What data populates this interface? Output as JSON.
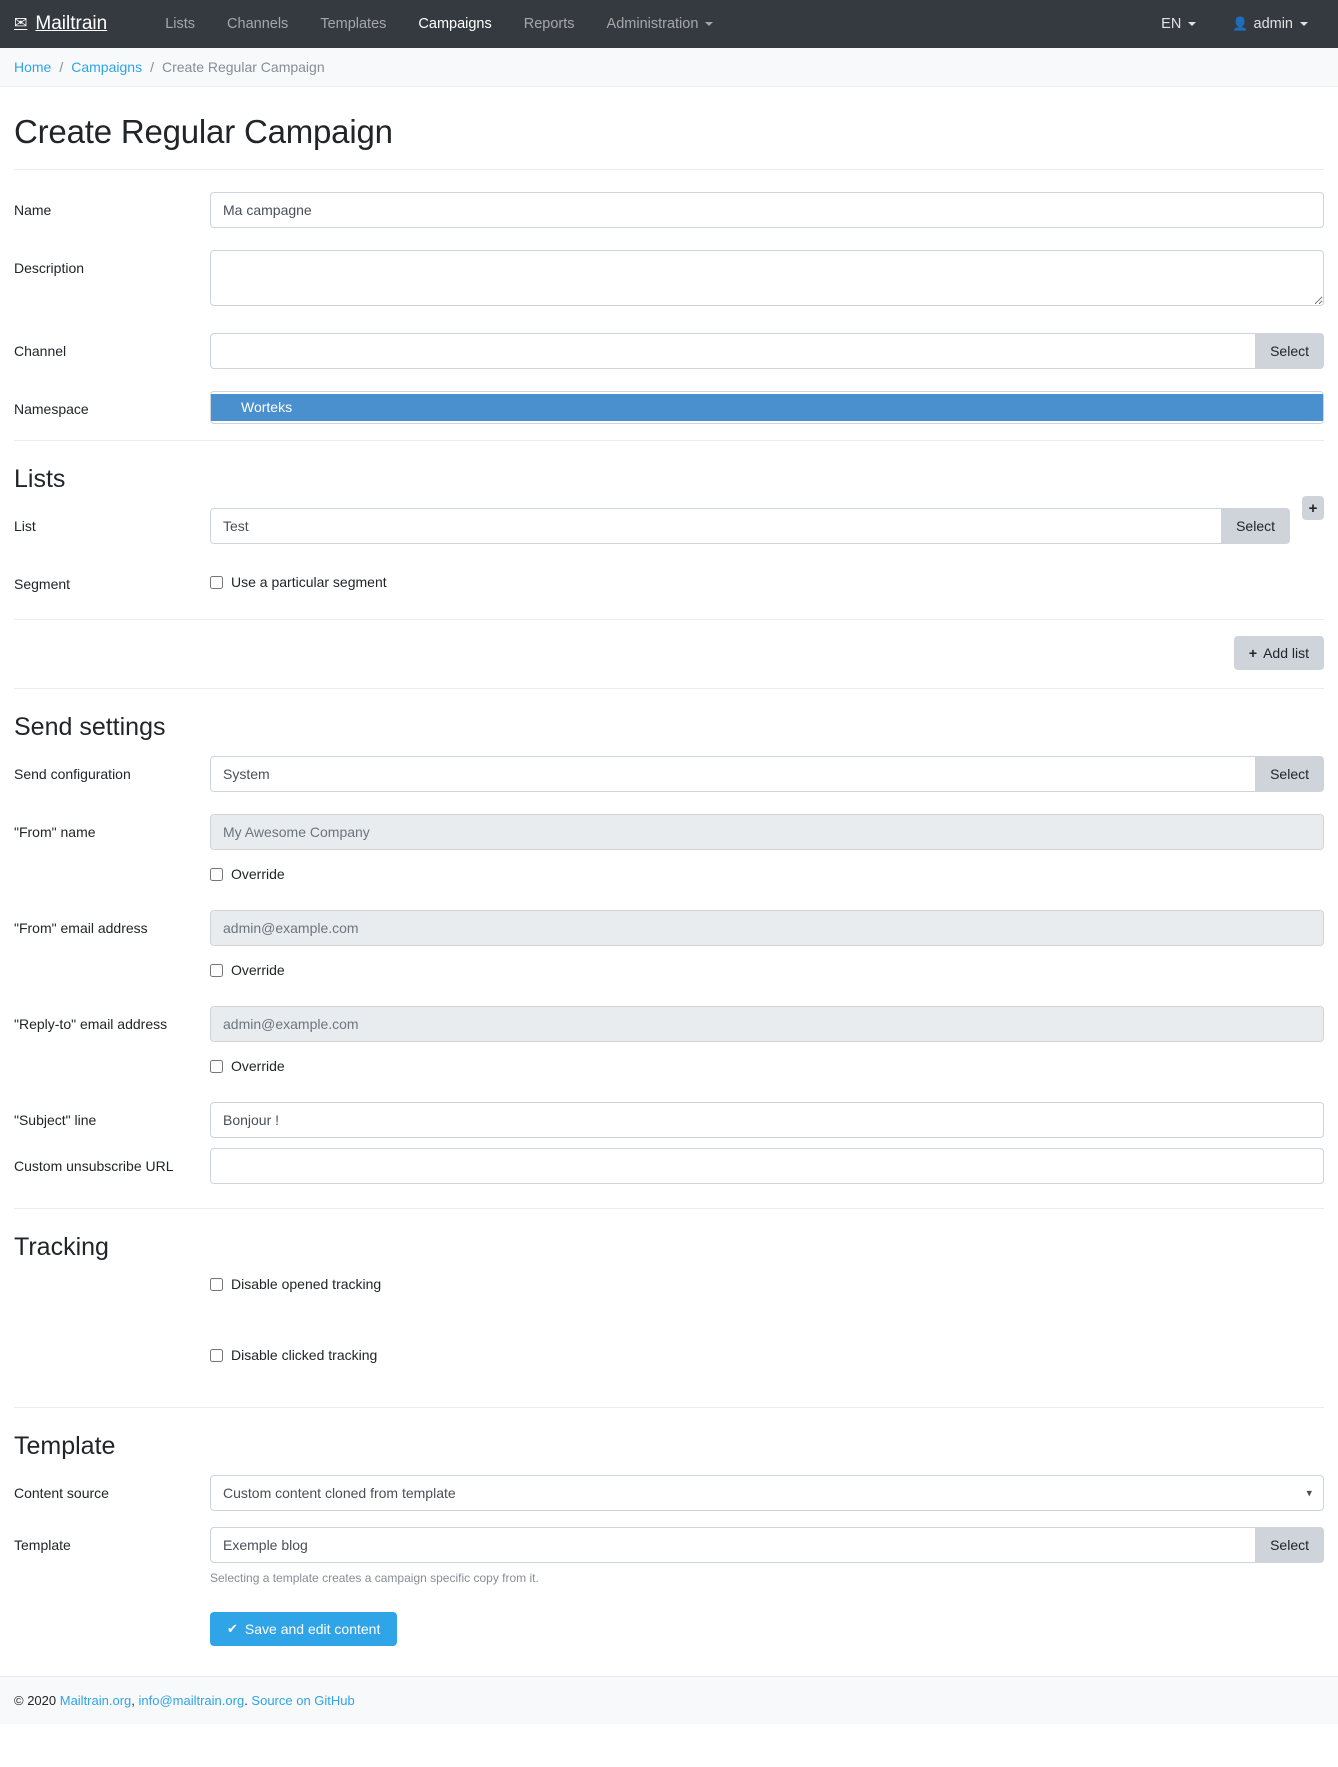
{
  "navbar": {
    "brand": "Mailtrain",
    "brand_icon": "envelope-icon",
    "items": [
      {
        "label": "Lists",
        "active": false
      },
      {
        "label": "Channels",
        "active": false
      },
      {
        "label": "Templates",
        "active": false
      },
      {
        "label": "Campaigns",
        "active": true
      },
      {
        "label": "Reports",
        "active": false
      },
      {
        "label": "Administration",
        "active": false,
        "has_caret": true
      }
    ],
    "language": "EN",
    "user": "admin"
  },
  "breadcrumb": {
    "home": "Home",
    "campaigns": "Campaigns",
    "current": "Create Regular Campaign",
    "separator": "/"
  },
  "page": {
    "title": "Create Regular Campaign"
  },
  "form": {
    "name": {
      "label": "Name",
      "value": "Ma campagne",
      "placeholder": ""
    },
    "description": {
      "label": "Description",
      "value": "",
      "placeholder": ""
    },
    "channel": {
      "label": "Channel",
      "value": "",
      "placeholder": "",
      "select_label": "Select"
    },
    "namespace": {
      "label": "Namespace",
      "options": [
        "Worteks"
      ],
      "selected": "Worteks"
    }
  },
  "lists": {
    "section_title": "Lists",
    "list": {
      "label": "List",
      "value": "Test",
      "select_label": "Select",
      "add_icon": "plus-icon"
    },
    "segment": {
      "label": "Segment",
      "checkbox_label": "Use a particular segment",
      "checked": false
    },
    "add_list_label": "Add list",
    "add_list_icon": "plus-icon"
  },
  "send_settings": {
    "section_title": "Send settings",
    "send_configuration": {
      "label": "Send configuration",
      "value": "System",
      "select_label": "Select"
    },
    "from_name": {
      "label": "\"From\" name",
      "value": "My Awesome Company",
      "disabled": true,
      "override_label": "Override",
      "override_checked": false
    },
    "from_email": {
      "label": "\"From\" email address",
      "value": "admin@example.com",
      "disabled": true,
      "override_label": "Override",
      "override_checked": false
    },
    "reply_to_email": {
      "label": "\"Reply-to\" email address",
      "value": "admin@example.com",
      "disabled": true,
      "override_label": "Override",
      "override_checked": false
    },
    "subject": {
      "label": "\"Subject\" line",
      "value": "Bonjour !"
    },
    "unsubscribe_url": {
      "label": "Custom unsubscribe URL",
      "value": ""
    }
  },
  "tracking": {
    "section_title": "Tracking",
    "disable_opened": {
      "label": "Disable opened tracking",
      "checked": false
    },
    "disable_clicked": {
      "label": "Disable clicked tracking",
      "checked": false
    }
  },
  "template": {
    "section_title": "Template",
    "content_source": {
      "label": "Content source",
      "value": "Custom content cloned from template",
      "chevron": "▾"
    },
    "template_field": {
      "label": "Template",
      "value": "Exemple blog",
      "select_label": "Select",
      "help": "Selecting a template creates a campaign specific copy from it."
    }
  },
  "actions": {
    "save_label": "Save and edit content",
    "save_icon": "check-icon"
  },
  "footer": {
    "copyright": "© 2020 ",
    "link1": "Mailtrain.org",
    "comma": ", ",
    "link2": "info@mailtrain.org",
    "period": ". ",
    "link3": "Source on GitHub"
  },
  "colors": {
    "navbar_bg": "#343a40",
    "accent": "#2fa4e7",
    "selected_option": "#4a90cf",
    "button_secondary": "#ced4da"
  }
}
